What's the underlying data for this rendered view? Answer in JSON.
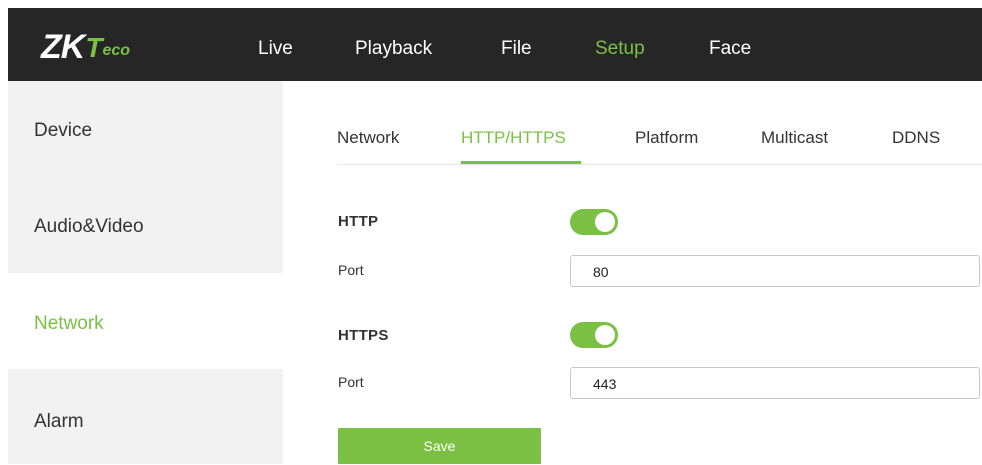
{
  "logo": {
    "part1": "ZK",
    "part2": "T",
    "part3": "eco"
  },
  "nav": [
    {
      "label": "Live"
    },
    {
      "label": "Playback"
    },
    {
      "label": "File"
    },
    {
      "label": "Setup",
      "active": true
    },
    {
      "label": "Face"
    }
  ],
  "sidebar": {
    "items": [
      {
        "label": "Device"
      },
      {
        "label": "Audio&Video"
      },
      {
        "label": "Network",
        "active": true
      },
      {
        "label": "Alarm"
      }
    ]
  },
  "tabs": [
    {
      "label": "Network"
    },
    {
      "label": "HTTP/HTTPS",
      "active": true
    },
    {
      "label": "Platform"
    },
    {
      "label": "Multicast"
    },
    {
      "label": "DDNS"
    }
  ],
  "form": {
    "http": {
      "label": "HTTP",
      "enabled": true,
      "port_label": "Port",
      "port_value": "80"
    },
    "https": {
      "label": "HTTPS",
      "enabled": true,
      "port_label": "Port",
      "port_value": "443"
    },
    "save_label": "Save"
  },
  "colors": {
    "accent": "#7ac143",
    "topbar": "#262626",
    "sidebar": "#f2f2f2"
  }
}
